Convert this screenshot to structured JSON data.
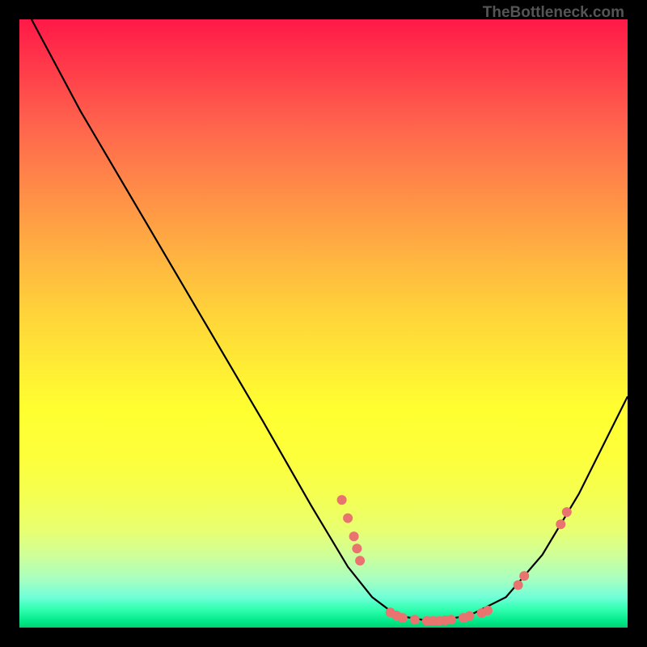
{
  "watermark": "TheBottleneck.com",
  "chart_data": {
    "type": "line",
    "title": "",
    "xlabel": "",
    "ylabel": "",
    "xlim": [
      0,
      100
    ],
    "ylim": [
      0,
      100
    ],
    "curve": [
      {
        "x": 2,
        "y": 100
      },
      {
        "x": 10,
        "y": 85
      },
      {
        "x": 20,
        "y": 68
      },
      {
        "x": 30,
        "y": 51
      },
      {
        "x": 40,
        "y": 34
      },
      {
        "x": 48,
        "y": 20
      },
      {
        "x": 54,
        "y": 10
      },
      {
        "x": 58,
        "y": 5
      },
      {
        "x": 62,
        "y": 2
      },
      {
        "x": 68,
        "y": 1
      },
      {
        "x": 74,
        "y": 2
      },
      {
        "x": 80,
        "y": 5
      },
      {
        "x": 86,
        "y": 12
      },
      {
        "x": 92,
        "y": 22
      },
      {
        "x": 100,
        "y": 38
      }
    ],
    "dots": [
      {
        "x": 53,
        "y": 21
      },
      {
        "x": 54,
        "y": 18
      },
      {
        "x": 55,
        "y": 15
      },
      {
        "x": 55.5,
        "y": 13
      },
      {
        "x": 56,
        "y": 11
      },
      {
        "x": 61,
        "y": 2.5
      },
      {
        "x": 62,
        "y": 2
      },
      {
        "x": 63,
        "y": 1.6
      },
      {
        "x": 65,
        "y": 1.3
      },
      {
        "x": 67,
        "y": 1.1
      },
      {
        "x": 68,
        "y": 1.1
      },
      {
        "x": 69,
        "y": 1.1
      },
      {
        "x": 70,
        "y": 1.2
      },
      {
        "x": 71,
        "y": 1.3
      },
      {
        "x": 73,
        "y": 1.6
      },
      {
        "x": 74,
        "y": 1.9
      },
      {
        "x": 76,
        "y": 2.4
      },
      {
        "x": 77,
        "y": 2.8
      },
      {
        "x": 82,
        "y": 7
      },
      {
        "x": 83,
        "y": 8.5
      },
      {
        "x": 89,
        "y": 17
      },
      {
        "x": 90,
        "y": 19
      }
    ]
  }
}
